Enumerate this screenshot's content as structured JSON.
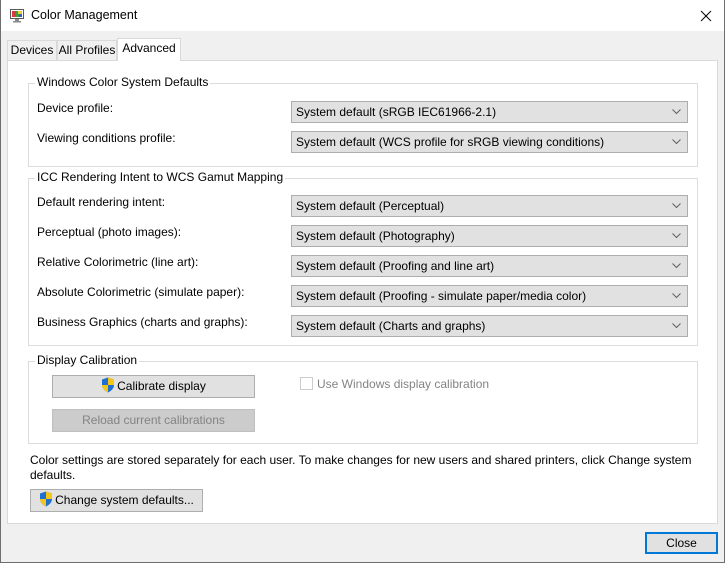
{
  "window": {
    "title": "Color Management",
    "icon": "monitor-color-icon",
    "close_icon": "close-icon"
  },
  "tabs": [
    {
      "label": "Devices",
      "active": false
    },
    {
      "label": "All Profiles",
      "active": false
    },
    {
      "label": "Advanced",
      "active": true
    }
  ],
  "wcs_defaults": {
    "legend": "Windows Color System Defaults",
    "rows": [
      {
        "label": "Device profile:",
        "value": "System default (sRGB IEC61966-2.1)"
      },
      {
        "label": "Viewing conditions profile:",
        "value": "System default (WCS profile for sRGB viewing conditions)"
      }
    ]
  },
  "icc_mapping": {
    "legend": "ICC Rendering Intent to WCS Gamut Mapping",
    "rows": [
      {
        "label": "Default rendering intent:",
        "value": "System default (Perceptual)"
      },
      {
        "label": "Perceptual (photo images):",
        "value": "System default (Photography)"
      },
      {
        "label": "Relative Colorimetric (line art):",
        "value": "System default (Proofing and line art)"
      },
      {
        "label": "Absolute Colorimetric (simulate paper):",
        "value": "System default (Proofing - simulate paper/media color)"
      },
      {
        "label": "Business Graphics (charts and graphs):",
        "value": "System default (Charts and graphs)"
      }
    ]
  },
  "calibration": {
    "legend": "Display Calibration",
    "calibrate_label": "Calibrate display",
    "reload_label": "Reload current calibrations",
    "reload_enabled": false,
    "use_windows_calibration_label": "Use Windows display calibration",
    "use_windows_calibration_checked": false,
    "use_windows_calibration_enabled": false
  },
  "info": {
    "text": "Color settings are stored separately for each user. To make changes for new users and shared printers, click Change system defaults.",
    "change_defaults_label": "Change system defaults..."
  },
  "footer": {
    "close_label": "Close"
  },
  "colors": {
    "accent": "#0078d7",
    "shield_blue": "#1f6fd0",
    "shield_yellow": "#f5c518"
  }
}
